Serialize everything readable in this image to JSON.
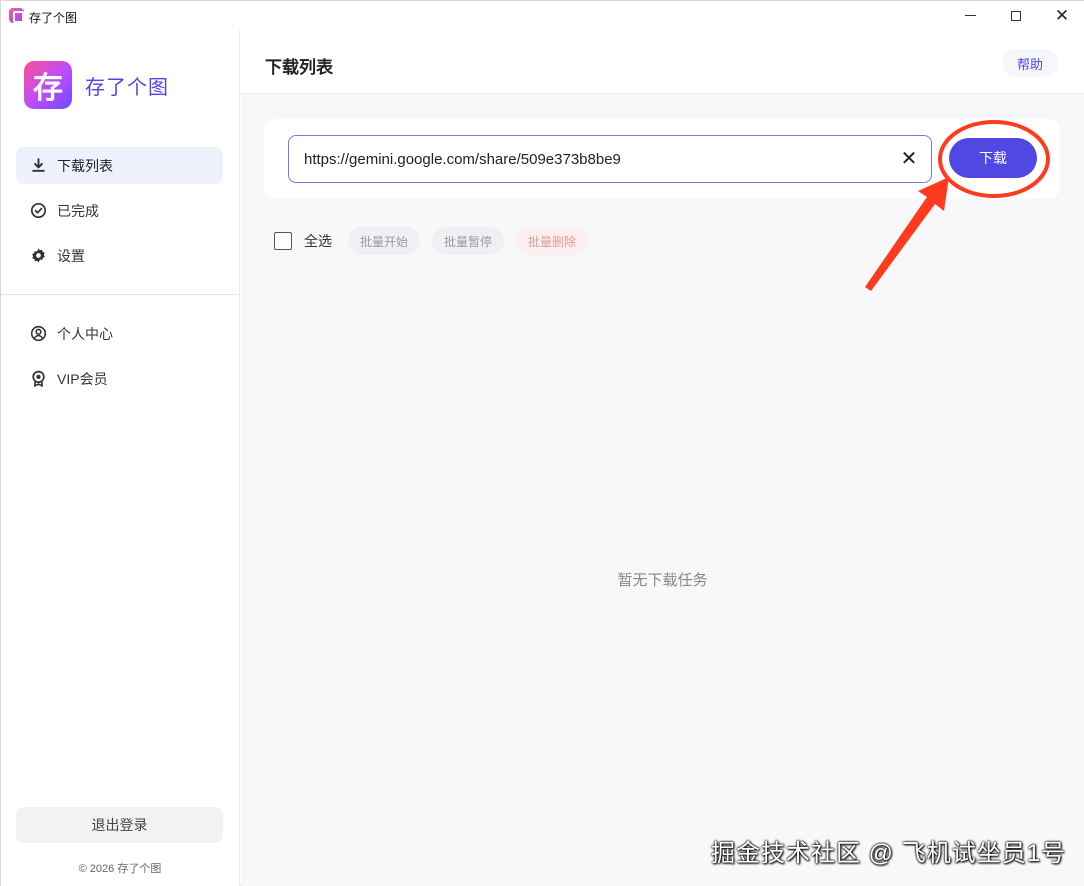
{
  "titlebar": {
    "app_title": "存了个图",
    "controls": [
      "minimize",
      "maximize",
      "close"
    ]
  },
  "sidebar": {
    "brand_glyph": "存",
    "brand_name": "存了个图",
    "nav_main": [
      {
        "label": "下载列表",
        "icon": "download-icon",
        "active": true
      },
      {
        "label": "已完成",
        "icon": "check-circle-icon",
        "active": false
      },
      {
        "label": "设置",
        "icon": "gear-icon",
        "active": false
      }
    ],
    "nav_account": [
      {
        "label": "个人中心",
        "icon": "user-circle-icon"
      },
      {
        "label": "VIP会员",
        "icon": "medal-icon"
      }
    ],
    "logout_label": "退出登录",
    "copyright": "© 2026 存了个图"
  },
  "main": {
    "title": "下载列表",
    "help_label": "帮助",
    "url_input": {
      "value": "https://gemini.google.com/share/509e373b8be9",
      "clear_symbol": "✕"
    },
    "download_label": "下载",
    "toolbar": {
      "select_all_label": "全选",
      "select_all_checked": false,
      "batch_start_label": "批量开始",
      "batch_pause_label": "批量暂停",
      "batch_delete_label": "批量删除"
    },
    "empty_text": "暂无下载任务"
  },
  "colors": {
    "accent": "#5147e3",
    "annotation": "#ff3b1f",
    "active_nav_bg": "#eef0fb"
  },
  "watermark": "掘金技术社区 @ 飞机试坐员1号"
}
